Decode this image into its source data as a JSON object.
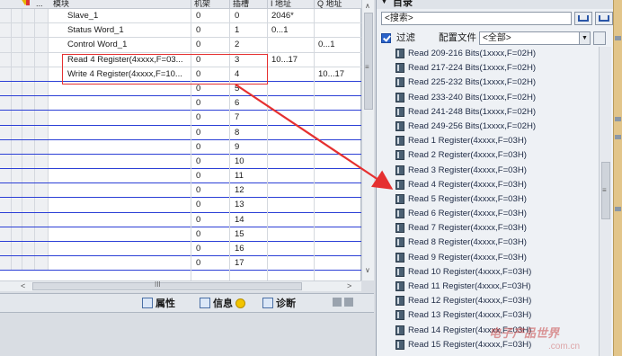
{
  "table": {
    "headers": {
      "module": "模块",
      "rack": "机架",
      "slot": "插槽",
      "i_address": "I 地址",
      "q_address": "Q 地址"
    },
    "header_ellipsis": "...",
    "rows": [
      {
        "name": "Slave_1",
        "rack": "0",
        "slot": "0",
        "i_addr": "2046*",
        "q_addr": ""
      },
      {
        "name": "Status Word_1",
        "rack": "0",
        "slot": "1",
        "i_addr": "0...1",
        "q_addr": ""
      },
      {
        "name": "Control Word_1",
        "rack": "0",
        "slot": "2",
        "i_addr": "",
        "q_addr": "0...1"
      },
      {
        "name": "Read 4 Register(4xxxx,F=03...",
        "rack": "0",
        "slot": "3",
        "i_addr": "10...17",
        "q_addr": ""
      },
      {
        "name": "Write 4 Register(4xxxx,F=10...",
        "rack": "0",
        "slot": "4",
        "i_addr": "",
        "q_addr": "10...17"
      },
      {
        "name": "",
        "rack": "0",
        "slot": "5",
        "i_addr": "",
        "q_addr": ""
      },
      {
        "name": "",
        "rack": "0",
        "slot": "6",
        "i_addr": "",
        "q_addr": ""
      },
      {
        "name": "",
        "rack": "0",
        "slot": "7",
        "i_addr": "",
        "q_addr": ""
      },
      {
        "name": "",
        "rack": "0",
        "slot": "8",
        "i_addr": "",
        "q_addr": ""
      },
      {
        "name": "",
        "rack": "0",
        "slot": "9",
        "i_addr": "",
        "q_addr": ""
      },
      {
        "name": "",
        "rack": "0",
        "slot": "10",
        "i_addr": "",
        "q_addr": ""
      },
      {
        "name": "",
        "rack": "0",
        "slot": "11",
        "i_addr": "",
        "q_addr": ""
      },
      {
        "name": "",
        "rack": "0",
        "slot": "12",
        "i_addr": "",
        "q_addr": ""
      },
      {
        "name": "",
        "rack": "0",
        "slot": "13",
        "i_addr": "",
        "q_addr": ""
      },
      {
        "name": "",
        "rack": "0",
        "slot": "14",
        "i_addr": "",
        "q_addr": ""
      },
      {
        "name": "",
        "rack": "0",
        "slot": "15",
        "i_addr": "",
        "q_addr": ""
      },
      {
        "name": "",
        "rack": "0",
        "slot": "16",
        "i_addr": "",
        "q_addr": ""
      },
      {
        "name": "",
        "rack": "0",
        "slot": "17",
        "i_addr": "",
        "q_addr": ""
      }
    ],
    "hscroll_left": "<",
    "hscroll_right": ">",
    "hscroll_grip": "III",
    "vscroll_up": "∧",
    "vscroll_down": "∨",
    "vscroll_grip": "≡"
  },
  "inspector": {
    "tab_properties": "属性",
    "tab_info": "信息",
    "tab_diagnostics": "诊断",
    "info_mark": "i"
  },
  "catalog": {
    "title": "目录",
    "search_placeholder": "<搜索>",
    "filter_label": "过滤",
    "profile_label": "配置文件",
    "profile_value": "<全部>",
    "items": [
      "Read 209-216 Bits(1xxxx,F=02H)",
      "Read 217-224 Bits(1xxxx,F=02H)",
      "Read 225-232 Bits(1xxxx,F=02H)",
      "Read 233-240 Bits(1xxxx,F=02H)",
      "Read 241-248 Bits(1xxxx,F=02H)",
      "Read 249-256 Bits(1xxxx,F=02H)",
      "Read 1 Register(4xxxx,F=03H)",
      "Read 2 Register(4xxxx,F=03H)",
      "Read 3 Register(4xxxx,F=03H)",
      "Read 4 Register(4xxxx,F=03H)",
      "Read 5 Register(4xxxx,F=03H)",
      "Read 6 Register(4xxxx,F=03H)",
      "Read 7 Register(4xxxx,F=03H)",
      "Read 8 Register(4xxxx,F=03H)",
      "Read 9 Register(4xxxx,F=03H)",
      "Read 10 Register(4xxxx,F=03H)",
      "Read 11 Register(4xxxx,F=03H)",
      "Read 12 Register(4xxxx,F=03H)",
      "Read 13 Register(4xxxx,F=03H)",
      "Read 14 Register(4xxxx,F=03H)",
      "Read 15 Register(4xxxx,F=03H)"
    ]
  },
  "watermark": {
    "line1": "电子产品世界",
    "line2": ".com.cn"
  },
  "colors": {
    "highlight_box": "#e53030",
    "arrow": "#e53030",
    "row_rule": "#2b3fd6",
    "accent": "#2a62c9"
  }
}
